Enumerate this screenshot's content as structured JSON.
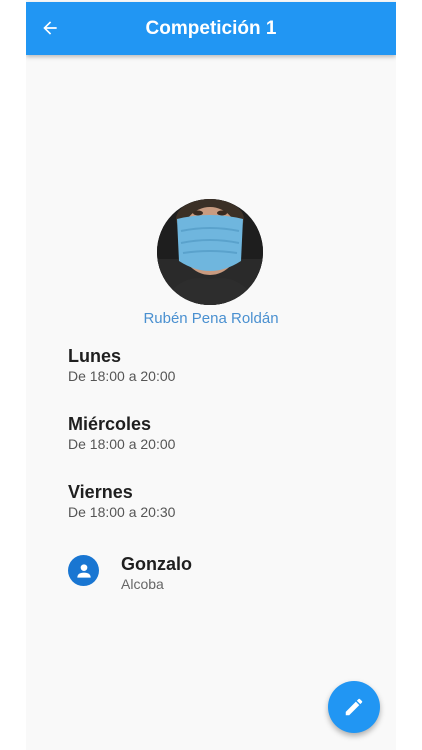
{
  "app_bar": {
    "title": "Competición 1",
    "back_icon": "arrow-back-icon",
    "color": "#2196f3"
  },
  "trainer": {
    "name": "Rubén Pena Roldán",
    "name_color": "#4a90d0"
  },
  "schedule": [
    {
      "day": "Lunes",
      "time": "De 18:00 a 20:00"
    },
    {
      "day": "Miércoles",
      "time": "De 18:00 a 20:00"
    },
    {
      "day": "Viernes",
      "time": "De 18:00 a 20:30"
    }
  ],
  "contact": {
    "name": "Gonzalo",
    "subtitle": "Alcoba",
    "icon": "person-icon"
  },
  "fab": {
    "icon": "edit-icon"
  }
}
